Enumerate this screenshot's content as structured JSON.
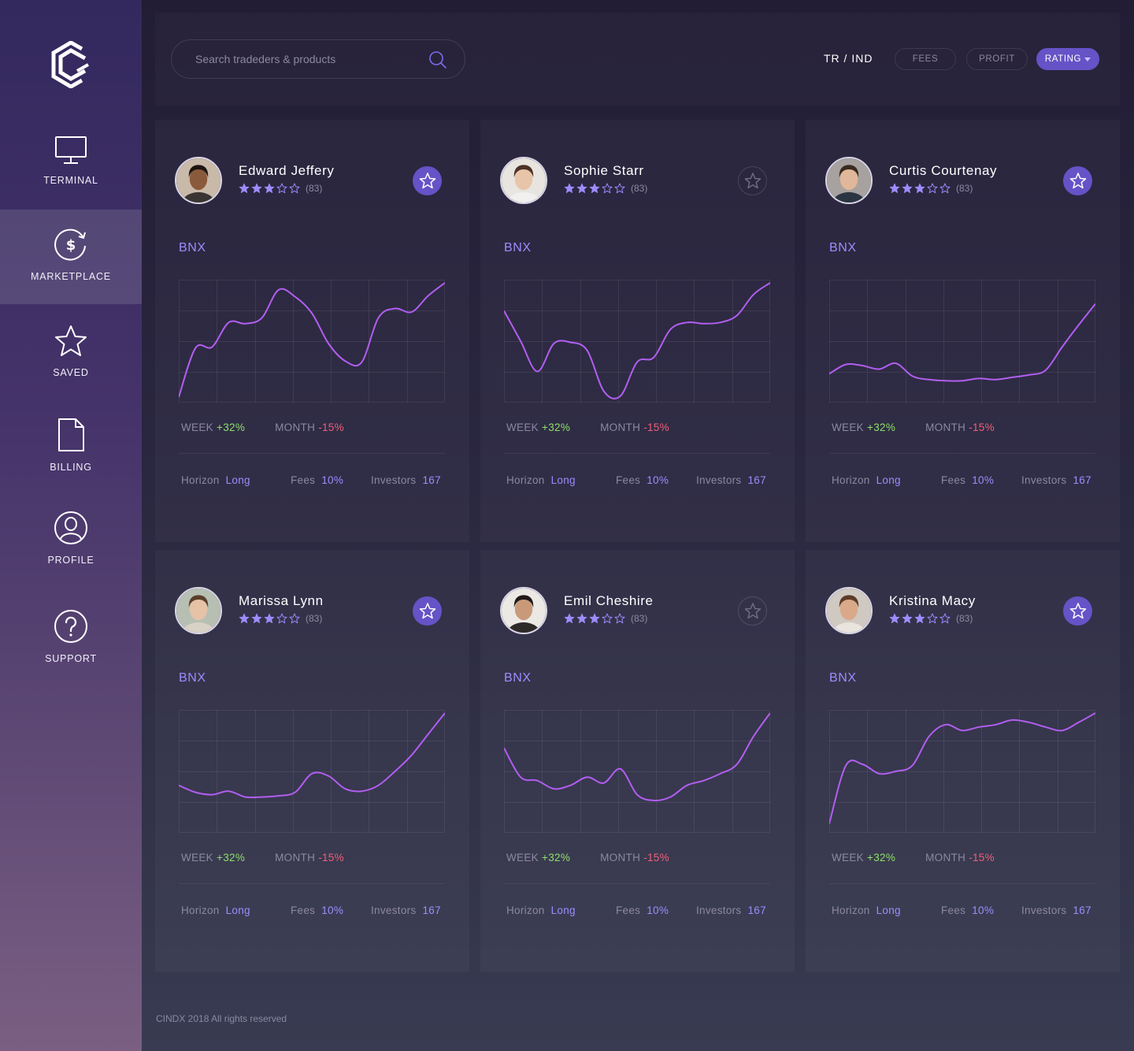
{
  "sidebar": {
    "items": [
      {
        "label": "TERMINAL",
        "icon": "monitor-icon",
        "active": false
      },
      {
        "label": "MARKETPLACE",
        "icon": "dollar-refresh-icon",
        "active": true
      },
      {
        "label": "SAVED",
        "icon": "star-icon",
        "active": false
      },
      {
        "label": "BILLING",
        "icon": "document-icon",
        "active": false
      },
      {
        "label": "PROFILE",
        "icon": "user-icon",
        "active": false
      },
      {
        "label": "SUPPORT",
        "icon": "question-icon",
        "active": false
      }
    ]
  },
  "header": {
    "search_placeholder": "Search tradeders & products",
    "region": "TR / IND",
    "filters": [
      {
        "label": "FEES",
        "active": false
      },
      {
        "label": "PROFIT",
        "active": false
      },
      {
        "label": "RATING",
        "active": true
      }
    ]
  },
  "colors": {
    "accent": "#6553c7",
    "line": "#b25ef0",
    "positive": "#8fe06a",
    "negative": "#ef5f7a",
    "label_accent": "#9d8cff"
  },
  "traders": [
    {
      "name": "Edward Jeffery",
      "stars": 3,
      "max_stars": 5,
      "rating_count": "(83)",
      "favorite": true,
      "ticker": "BNX",
      "week_label": "WEEK",
      "week": "+32%",
      "month_label": "MONTH",
      "month": "-15%",
      "horizon_label": "Horizon",
      "horizon": "Long",
      "fees_label": "Fees",
      "fees": "10%",
      "investors_label": "Investors",
      "investors": "167",
      "chart_data": {
        "type": "line",
        "values": [
          2,
          44,
          45,
          66,
          65,
          70,
          94,
          88,
          74,
          48,
          33,
          32,
          70,
          78,
          75,
          89,
          100
        ]
      }
    },
    {
      "name": "Sophie Starr",
      "stars": 3,
      "max_stars": 5,
      "rating_count": "(83)",
      "favorite": false,
      "ticker": "BNX",
      "week_label": "WEEK",
      "week": "+32%",
      "month_label": "MONTH",
      "month": "-15%",
      "horizon_label": "Horizon",
      "horizon": "Long",
      "fees_label": "Fees",
      "fees": "10%",
      "investors_label": "Investors",
      "investors": "167",
      "chart_data": {
        "type": "line",
        "values": [
          76,
          50,
          24,
          48,
          49,
          42,
          7,
          3,
          32,
          36,
          60,
          66,
          65,
          66,
          72,
          90,
          100
        ]
      }
    },
    {
      "name": "Curtis Courtenay",
      "stars": 3,
      "max_stars": 5,
      "rating_count": "(83)",
      "favorite": true,
      "ticker": "BNX",
      "week_label": "WEEK",
      "week": "+32%",
      "month_label": "MONTH",
      "month": "-15%",
      "horizon_label": "Horizon",
      "horizon": "Long",
      "fees_label": "Fees",
      "fees": "10%",
      "investors_label": "Investors",
      "investors": "167",
      "chart_data": {
        "type": "line",
        "values": [
          22,
          30,
          29,
          26,
          31,
          20,
          17,
          16,
          16,
          18,
          17,
          19,
          21,
          25,
          45,
          64,
          82
        ]
      }
    },
    {
      "name": "Marissa Lynn",
      "stars": 3,
      "max_stars": 5,
      "rating_count": "(83)",
      "favorite": true,
      "ticker": "BNX",
      "week_label": "WEEK",
      "week": "+32%",
      "month_label": "MONTH",
      "month": "-15%",
      "horizon_label": "Horizon",
      "horizon": "Long",
      "fees_label": "Fees",
      "fees": "10%",
      "investors_label": "Investors",
      "investors": "167",
      "chart_data": {
        "type": "line",
        "values": [
          38,
          32,
          30,
          33,
          28,
          28,
          29,
          32,
          48,
          46,
          35,
          33,
          38,
          50,
          64,
          82,
          100
        ]
      }
    },
    {
      "name": "Emil Cheshire",
      "stars": 3,
      "max_stars": 5,
      "rating_count": "(83)",
      "favorite": false,
      "ticker": "BNX",
      "week_label": "WEEK",
      "week": "+32%",
      "month_label": "MONTH",
      "month": "-15%",
      "horizon_label": "Horizon",
      "horizon": "Long",
      "fees_label": "Fees",
      "fees": "10%",
      "investors_label": "Investors",
      "investors": "167",
      "chart_data": {
        "type": "line",
        "values": [
          70,
          45,
          42,
          35,
          38,
          45,
          40,
          52,
          30,
          25,
          28,
          38,
          42,
          48,
          56,
          80,
          100
        ]
      }
    },
    {
      "name": "Kristina Macy",
      "stars": 3,
      "max_stars": 5,
      "rating_count": "(83)",
      "favorite": true,
      "ticker": "BNX",
      "week_label": "WEEK",
      "week": "+32%",
      "month_label": "MONTH",
      "month": "-15%",
      "horizon_label": "Horizon",
      "horizon": "Long",
      "fees_label": "Fees",
      "fees": "10%",
      "investors_label": "Investors",
      "investors": "167",
      "chart_data": {
        "type": "line",
        "values": [
          5,
          55,
          56,
          48,
          50,
          55,
          80,
          90,
          85,
          88,
          90,
          94,
          92,
          88,
          85,
          92,
          100
        ]
      }
    }
  ],
  "footer": {
    "text": "CINDX 2018 All rights reserved"
  }
}
